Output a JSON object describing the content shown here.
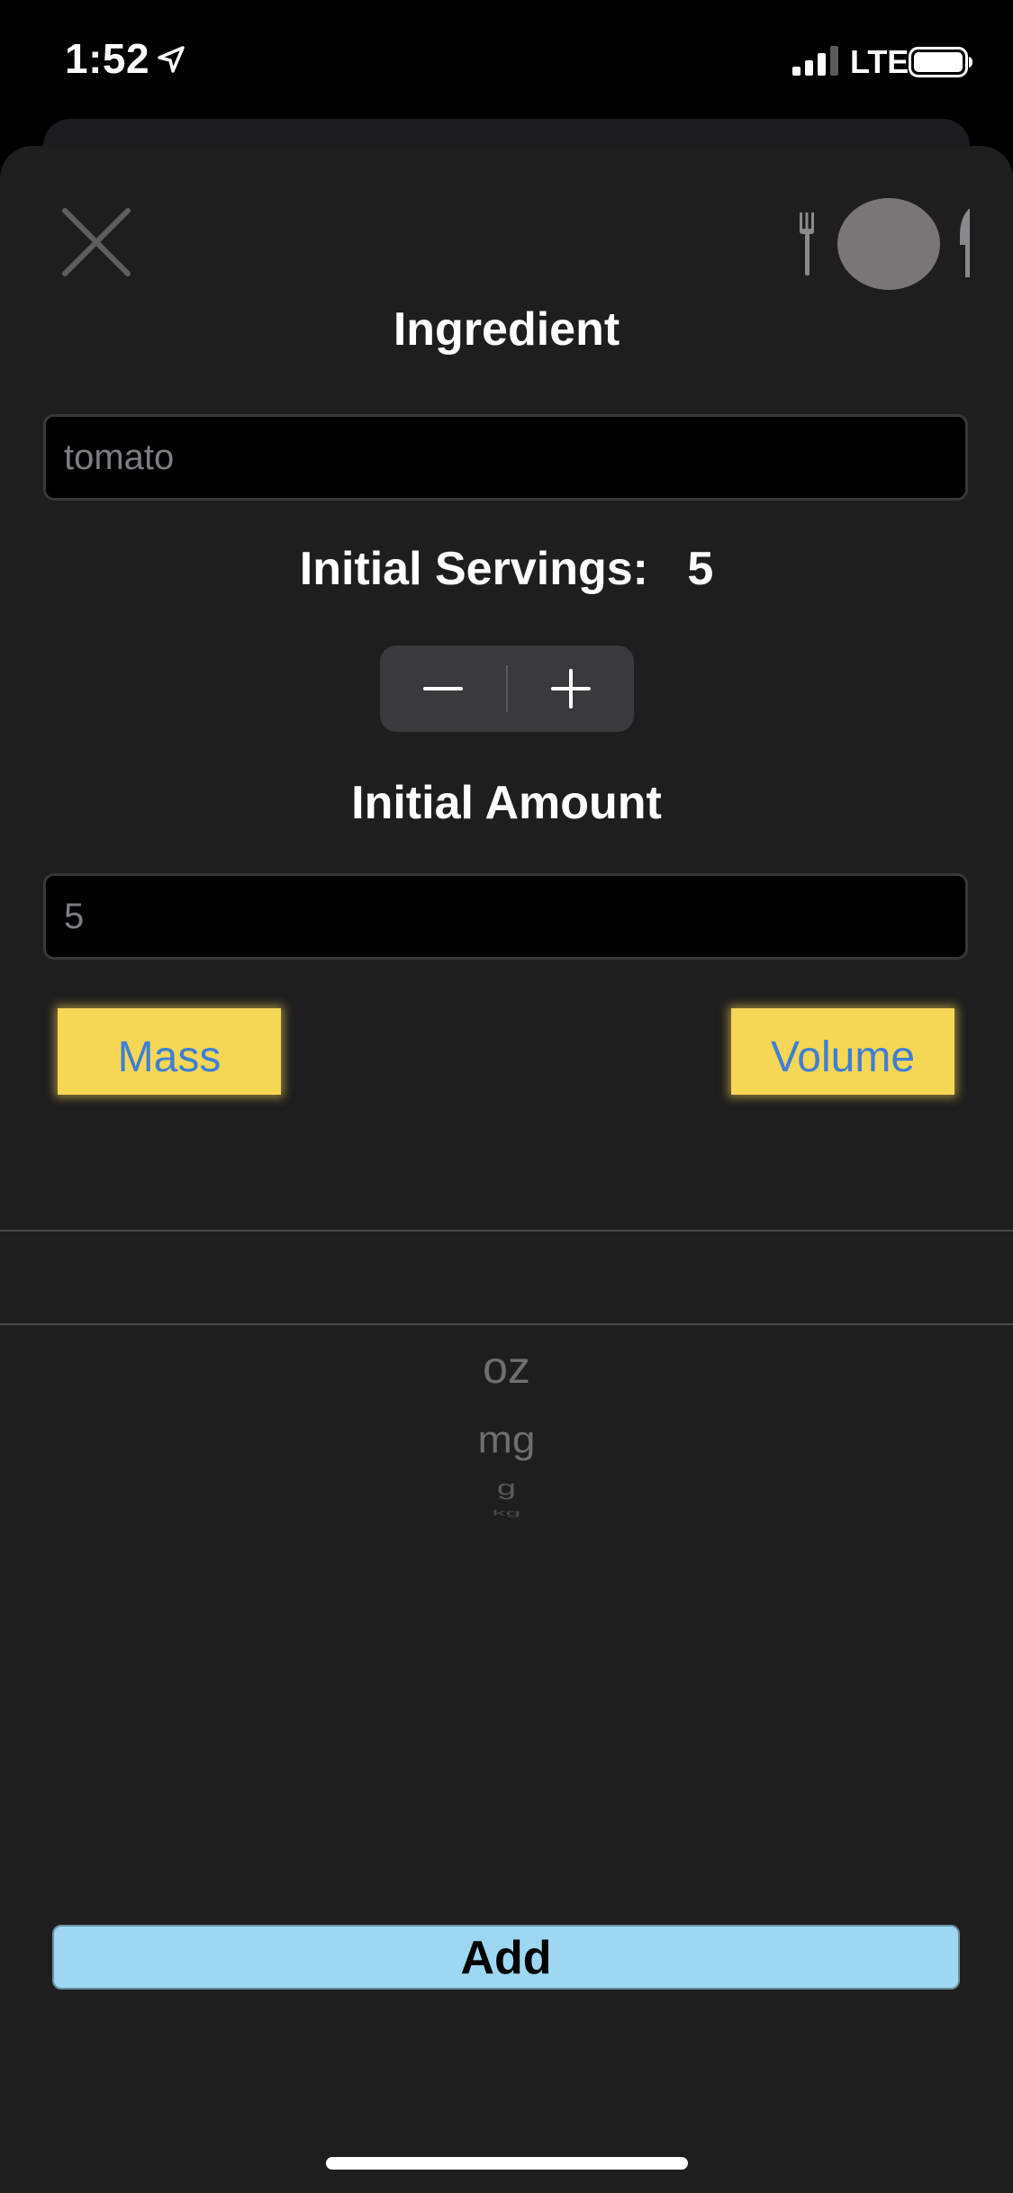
{
  "status_bar": {
    "time": "1:52",
    "network": "LTE",
    "icons": [
      "location-arrow-icon",
      "signal-bars-icon",
      "battery-icon"
    ]
  },
  "header": {
    "close_icon": "close-icon",
    "avatar_icons": [
      "fork-icon",
      "plate-icon",
      "knife-icon"
    ]
  },
  "form": {
    "ingredient_label": "Ingredient",
    "ingredient_value": "tomato",
    "servings_label": "Initial Servings:",
    "servings_value": "5",
    "amount_label": "Initial Amount",
    "amount_value": "5",
    "mass_button": "Mass",
    "volume_button": "Volume"
  },
  "picker": {
    "selected": "",
    "items": [
      "oz",
      "mg",
      "g",
      "kg"
    ]
  },
  "actions": {
    "add_label": "Add"
  },
  "colors": {
    "background": "#1e1e1e",
    "unit_button_bg": "#f6d655",
    "unit_button_text": "#3e7fd6",
    "add_button_bg": "#9dd7f2"
  }
}
